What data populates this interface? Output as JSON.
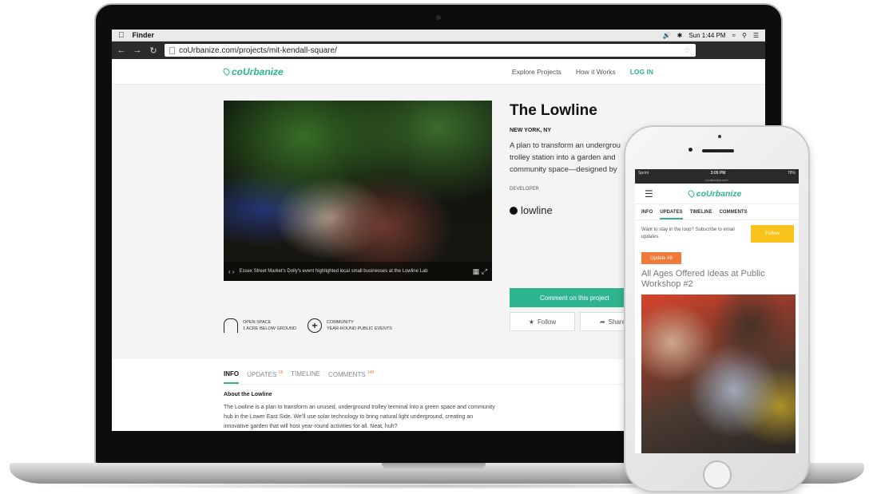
{
  "mac": {
    "menu_app": "Finder",
    "clock": "Sun 1:44 PM"
  },
  "browser": {
    "url": "coUrbanize.com/projects/mit-kendall-square/"
  },
  "site": {
    "logo": "coUrbanize",
    "nav": [
      "Explore Projects",
      "How it Works",
      "LOG IN"
    ]
  },
  "project": {
    "title": "The Lowline",
    "location": "NEW YORK, NY",
    "desc_lines": [
      "A plan to transform an undergrou",
      "trolley station into a garden and",
      "community space—designed by"
    ],
    "developer_label": "DEVELOPER",
    "developer_name": "lowline",
    "photo_caption": "Essex Street Market's Dolly's event highlighted local small businesses at the Lowline Lab",
    "cta": "Comment on this project",
    "follow": "Follow",
    "share": "Share"
  },
  "features": [
    {
      "line1": "OPEN SPACE",
      "line2": "1 ACRE BELOW GROUND",
      "icon": "tree-icon"
    },
    {
      "line1": "COMMUNITY",
      "line2": "YEAR-ROUND PUBLIC EVENTS",
      "icon": "plus-circle-icon"
    }
  ],
  "tabs": [
    {
      "label": "INFO",
      "count": ""
    },
    {
      "label": "UPDATES",
      "count": "18"
    },
    {
      "label": "TIMELINE",
      "count": ""
    },
    {
      "label": "COMMENTS",
      "count": "149"
    }
  ],
  "about": {
    "heading": "About the Lowline",
    "text": "The Lowline is a plan to transform an unused, underground trolley terminal into a green space and community hub in the Lower East Side. We'll use solar technology to bring natural light underground, creating an innovative garden that will host year-round activities for all. Neat, huh?"
  },
  "phone": {
    "carrier": "Sprint",
    "time": "3:05 PM",
    "battery": "78%",
    "url": "courbanize.com",
    "logo": "coUrbanize",
    "tabs": [
      "INFO",
      "UPDATES",
      "TIMELINE",
      "COMMENTS"
    ],
    "loop_text": "Want to stay in the loop? Subscribe to email updates.",
    "follow": "Follow",
    "badge": "Update #8",
    "title": "All Ages Offered Ideas at Public Workshop #2"
  },
  "colors": {
    "brand_green": "#2eb58f",
    "follow_yellow": "#f8c31a",
    "badge_orange": "#f07a3a"
  }
}
